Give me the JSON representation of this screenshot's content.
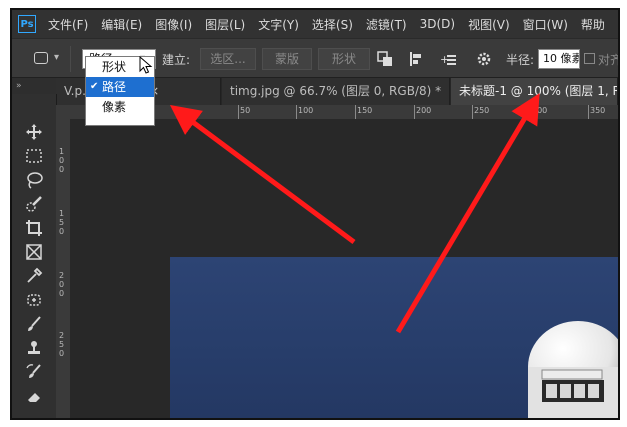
{
  "app": {
    "logo": "Ps"
  },
  "menu": [
    "文件(F)",
    "编辑(E)",
    "图像(I)",
    "图层(L)",
    "文字(Y)",
    "选择(S)",
    "滤镜(T)",
    "3D(D)",
    "视图(V)",
    "窗口(W)",
    "帮助"
  ],
  "options": {
    "mode_value": "路径",
    "build_label": "建立:",
    "selection_label": "选区...",
    "mask_label": "蒙版",
    "shape_label": "形状",
    "radius_label": "半径:",
    "radius_value": "10 像素",
    "align_label": "对齐"
  },
  "dropdown": {
    "items": [
      {
        "label": "形状",
        "selected": false
      },
      {
        "label": "路径",
        "selected": true
      },
      {
        "label": "像素",
        "selected": false
      }
    ]
  },
  "toolstrip_head": "»",
  "tabs": [
    {
      "label": "V.p... GB/8) *",
      "close": "×",
      "active": false
    },
    {
      "label": "timg.jpg @ 66.7% (图层 0, RGB/8) *",
      "close": "×",
      "active": false
    },
    {
      "label": "未标题-1 @ 100% (图层 1, R",
      "close": "",
      "active": true
    }
  ],
  "ruler_top": [
    "50",
    "100",
    "150",
    "200",
    "250",
    "300",
    "350"
  ],
  "ruler_left": [
    "1",
    "0",
    "0",
    "1",
    "5",
    "0",
    "2",
    "0",
    "0",
    "2",
    "5",
    "0"
  ],
  "colors": {
    "menubar": "#323232",
    "optbar": "#3a3a3a",
    "canvas": "#282828",
    "doc": "#2a3f6e",
    "dropdown_selected": "#1e6fd0",
    "arrow": "#ff1a1a"
  }
}
